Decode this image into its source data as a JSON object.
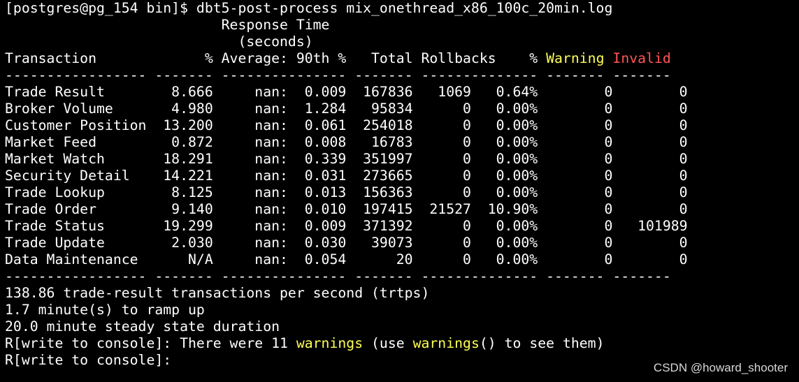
{
  "terminal": {
    "prompt_command": "[postgres@pg_154 bin]$ dbt5-post-process mix_onethread_x86_100c_20min.log",
    "header_1": "                          Response Time",
    "header_2": "                            (seconds)",
    "header_3_main": "Transaction             % Average: 90th %   Total Rollbacks    % ",
    "header_3_warning": "Warning",
    "header_3_sep": " ",
    "header_3_invalid": "Invalid",
    "separator": "----------------- ------- --------------- ------- -------------- ------- -------",
    "rows": [
      "Trade Result        8.666     nan:  0.009  167836   1069   0.64%        0        0",
      "Broker Volume       4.980     nan:  1.284   95834      0   0.00%        0        0",
      "Customer Position  13.200     nan:  0.061  254018      0   0.00%        0        0",
      "Market Feed         0.872     nan:  0.008   16783      0   0.00%        0        0",
      "Market Watch       18.291     nan:  0.339  351997      0   0.00%        0        0",
      "Security Detail    14.221     nan:  0.031  273665      0   0.00%        0        0",
      "Trade Lookup        8.125     nan:  0.013  156363      0   0.00%        0        0",
      "Trade Order         9.140     nan:  0.010  197415  21527  10.90%        0        0",
      "Trade Status       19.299     nan:  0.009  371392      0   0.00%        0   101989",
      "Trade Update        2.030     nan:  0.030   39073      0   0.00%        0        0",
      "Data Maintenance      N/A     nan:  0.054      20      0   0.00%        0        0"
    ],
    "summary": [
      "138.86 trade-result transactions per second (trtps)",
      "1.7 minute(s) to ramp up",
      "20.0 minute steady state duration"
    ],
    "console_1_a": "R[write to console]: There were 11 ",
    "console_1_b": "warnings",
    "console_1_c": " (use ",
    "console_1_d": "warnings",
    "console_1_e": "() to see them)",
    "console_2": "R[write to console]: "
  },
  "watermark": "CSDN @howard_shooter",
  "colors": {
    "background": "#000000",
    "text": "#ffffff",
    "warning": "#ffff55",
    "invalid": "#ff5555"
  }
}
